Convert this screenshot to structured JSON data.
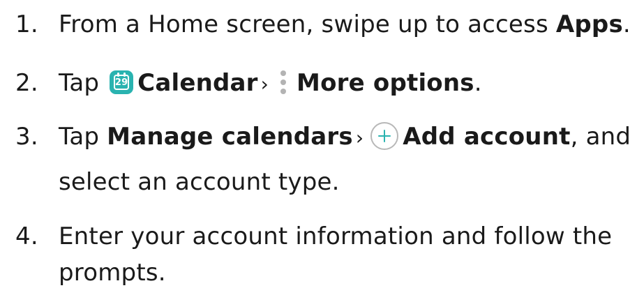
{
  "steps": [
    {
      "number": "1.",
      "segments": {
        "a": "From a Home screen, swipe up to access ",
        "b": "Apps",
        "c": "."
      }
    },
    {
      "number": "2.",
      "segments": {
        "a": "Tap ",
        "cal_icon_day": "29",
        "b": "Calendar",
        "sep": "›",
        "c": "More options",
        "d": "."
      }
    },
    {
      "number": "3.",
      "segments": {
        "a": "Tap ",
        "b": "Manage calendars",
        "sep": "›",
        "c": "Add account",
        "d": ", and",
        "e": "select an account type."
      }
    },
    {
      "number": "4.",
      "segments": {
        "a": "Enter your account information and follow the",
        "b": "prompts."
      }
    }
  ],
  "icons": {
    "calendar": "calendar-icon",
    "more": "more-options-icon",
    "add": "plus-icon"
  },
  "colors": {
    "text": "#1a1a1a",
    "accent": "#2ab3b0",
    "icon_gray": "#b3b3b3"
  }
}
